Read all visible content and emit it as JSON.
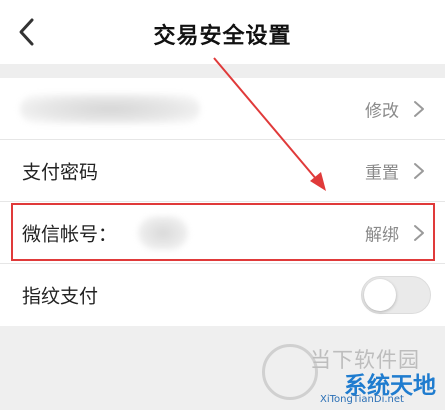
{
  "header": {
    "title": "交易安全设置",
    "back_icon": "chevron-left-icon"
  },
  "rows": [
    {
      "label": "",
      "action": "修改"
    },
    {
      "label": "支付密码",
      "action": "重置"
    },
    {
      "label": "微信帐号：",
      "action": "解绑"
    },
    {
      "label": "指纹支付",
      "toggle_on": false
    }
  ],
  "annotation": {
    "highlight_color": "#e03a3a"
  },
  "watermark": {
    "site_name": "当下软件园",
    "brand": "系统天地",
    "url": "XiTongTianDi.net"
  }
}
